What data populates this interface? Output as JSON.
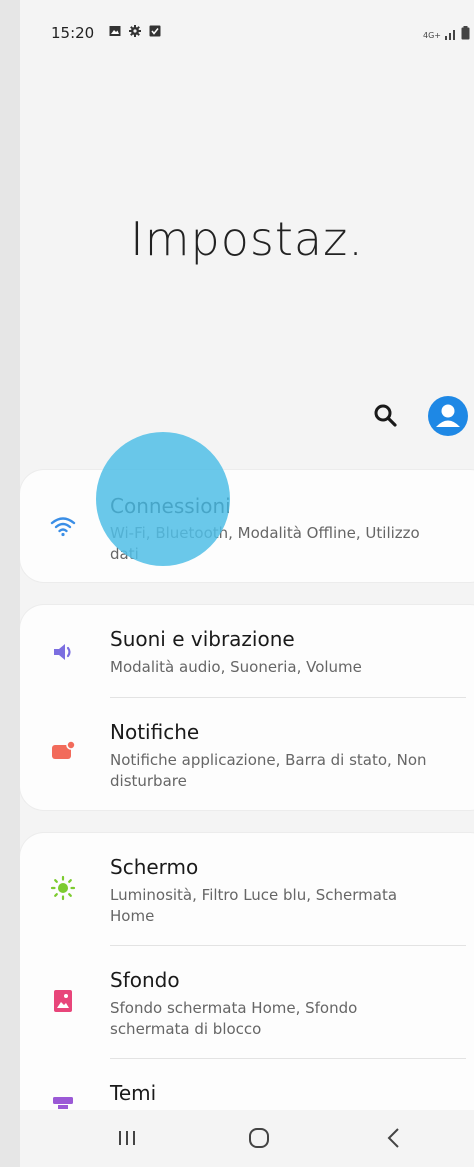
{
  "status_bar": {
    "time": "15:20",
    "network": "4G+",
    "icons": [
      "image-icon",
      "gear-icon",
      "check-box-icon"
    ]
  },
  "header": {
    "title": "Impostaz."
  },
  "toolbar": {
    "search_icon": "search-icon",
    "avatar_icon": "account-icon"
  },
  "groups": [
    {
      "items": [
        {
          "title": "Connessioni",
          "subtitle": "Wi-Fi, Bluetooth, Modalità Offline, Utilizzo dati",
          "icon": "wifi-icon",
          "color": "#3a8ee6"
        }
      ]
    },
    {
      "items": [
        {
          "title": "Suoni e vibrazione",
          "subtitle": "Modalità audio, Suoneria, Volume",
          "icon": "volume-icon",
          "color": "#7b6ee0"
        },
        {
          "title": "Notifiche",
          "subtitle": "Notifiche applicazione, Barra di stato, Non disturbare",
          "icon": "notification-icon",
          "color": "#f26b5b"
        }
      ]
    },
    {
      "items": [
        {
          "title": "Schermo",
          "subtitle": "Luminosità, Filtro Luce blu, Schermata Home",
          "icon": "brightness-icon",
          "color": "#7ccb2f"
        },
        {
          "title": "Sfondo",
          "subtitle": "Sfondo schermata Home, Sfondo schermata di blocco",
          "icon": "wallpaper-icon",
          "color": "#e8457a"
        },
        {
          "title": "Temi",
          "subtitle": "",
          "icon": "themes-icon",
          "color": "#9b59d6"
        }
      ]
    }
  ],
  "nav_bar": {
    "recent": "recent-apps-icon",
    "home": "home-icon",
    "back": "back-icon"
  }
}
